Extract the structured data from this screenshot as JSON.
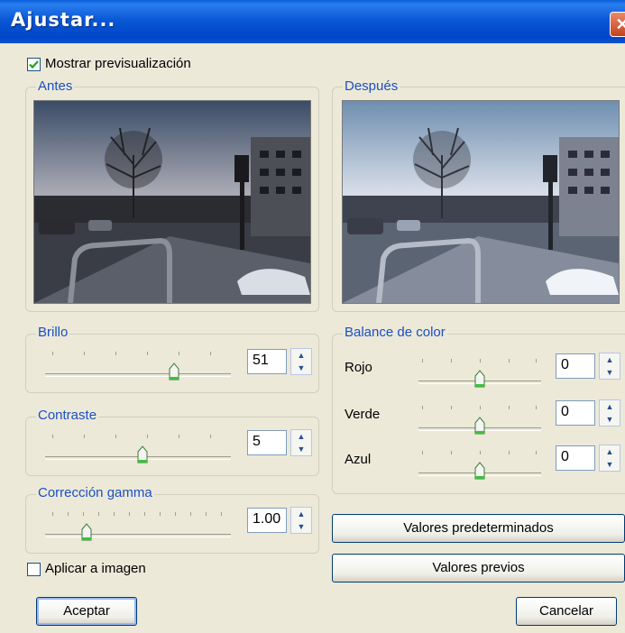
{
  "window": {
    "title": "Ajustar..."
  },
  "preview": {
    "label": "Mostrar previsualización",
    "checked": true
  },
  "before": {
    "label": "Antes"
  },
  "after": {
    "label": "Después"
  },
  "brightness": {
    "label": "Brillo",
    "value": "51"
  },
  "contrast": {
    "label": "Contraste",
    "value": "5"
  },
  "gamma": {
    "label": "Corrección gamma",
    "value": "1.00"
  },
  "color_balance": {
    "label": "Balance de color",
    "red_label": "Rojo",
    "red_value": "0",
    "green_label": "Verde",
    "green_value": "0",
    "blue_label": "Azul",
    "blue_value": "0"
  },
  "apply": {
    "label": "Aplicar a imagen",
    "checked": false
  },
  "buttons": {
    "defaults": "Valores predeterminados",
    "previous": "Valores previos",
    "ok": "Aceptar",
    "cancel": "Cancelar"
  },
  "colors": {
    "legend": "#1b4fc4",
    "titlebar": "#0a58d6"
  }
}
